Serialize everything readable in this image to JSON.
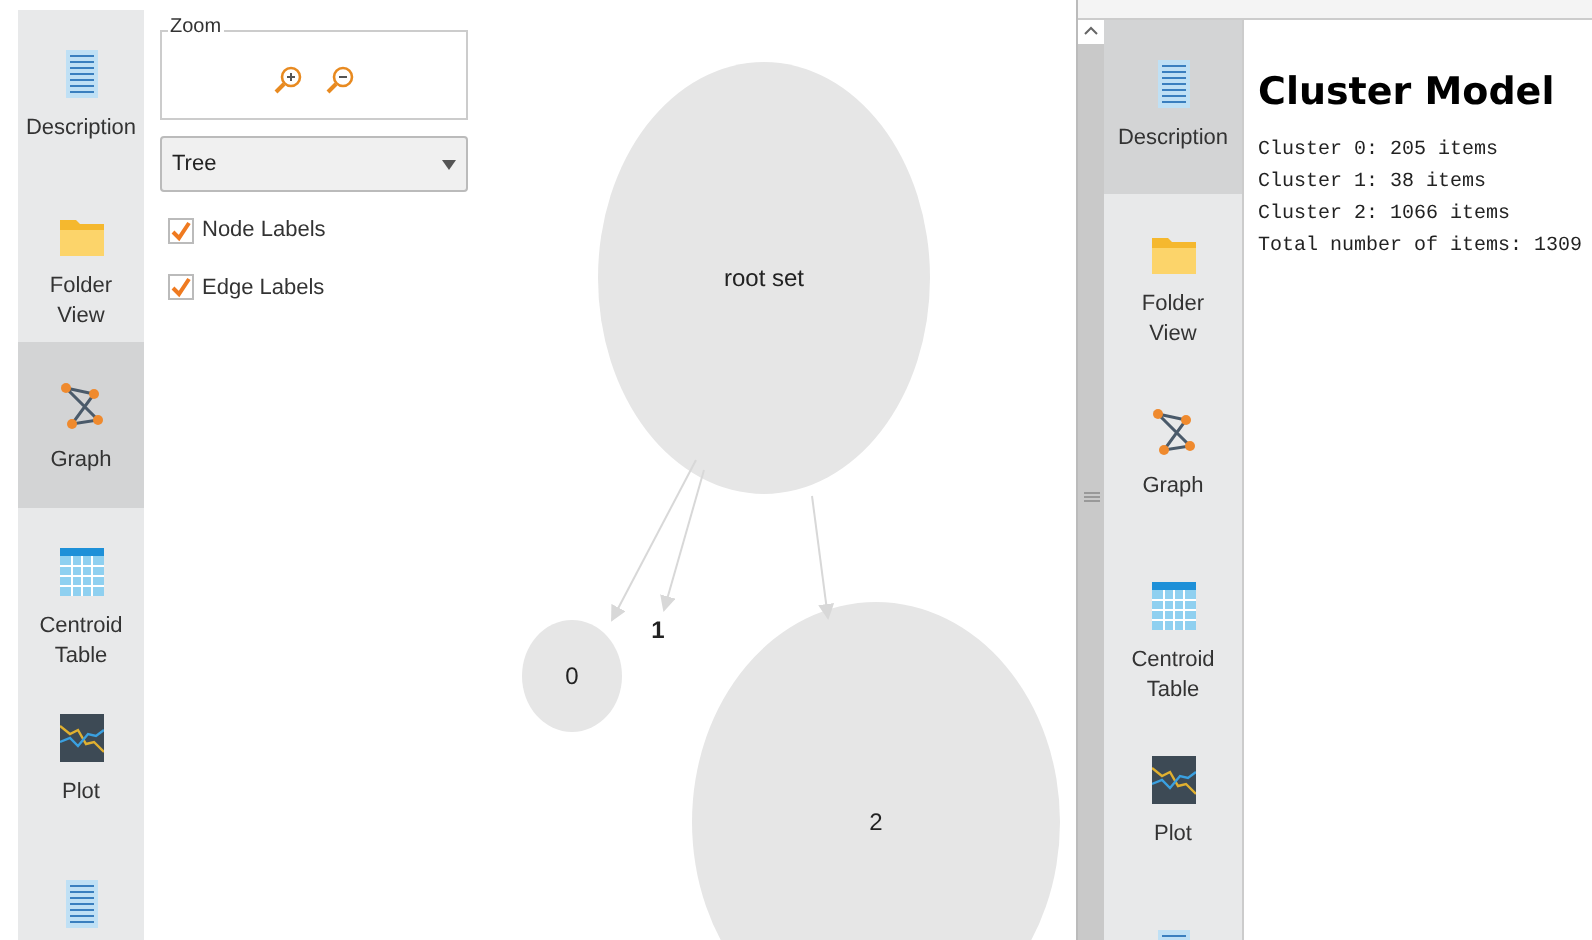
{
  "left_sidebar": {
    "items": [
      {
        "kind": "description",
        "label": "Description",
        "selected": false
      },
      {
        "kind": "folder",
        "label": "Folder View",
        "selected": false
      },
      {
        "kind": "graph",
        "label": "Graph",
        "selected": true
      },
      {
        "kind": "table",
        "label": "Centroid Table",
        "selected": false
      },
      {
        "kind": "plot",
        "label": "Plot",
        "selected": false
      },
      {
        "kind": "description",
        "selected": false
      }
    ]
  },
  "zoom": {
    "label": "Zoom"
  },
  "layout_select": {
    "value": "Tree"
  },
  "options": [
    {
      "label": "Node Labels",
      "checked": true
    },
    {
      "label": "Edge Labels",
      "checked": true
    }
  ],
  "graph": {
    "nodes": [
      {
        "kind": "circle",
        "label": "root set"
      },
      {
        "kind": "circle",
        "label": "0"
      },
      {
        "kind": "label",
        "label": "1"
      },
      {
        "kind": "circle",
        "label": "2"
      }
    ]
  },
  "right_sidebar": {
    "items": [
      {
        "kind": "description",
        "label": "Description",
        "selected": true
      },
      {
        "kind": "folder",
        "label": "Folder View",
        "selected": false
      },
      {
        "kind": "graph",
        "label": "Graph",
        "selected": false
      },
      {
        "kind": "table",
        "label": "Centroid Table",
        "selected": false
      },
      {
        "kind": "plot",
        "label": "Plot",
        "selected": false
      },
      {
        "kind": "description",
        "selected": false
      }
    ]
  },
  "content": {
    "title": "Cluster Model",
    "lines": [
      "Cluster 0: 205 items",
      "Cluster 1: 38 items",
      "Cluster 2: 1066 items",
      "Total number of items: 1309"
    ]
  }
}
